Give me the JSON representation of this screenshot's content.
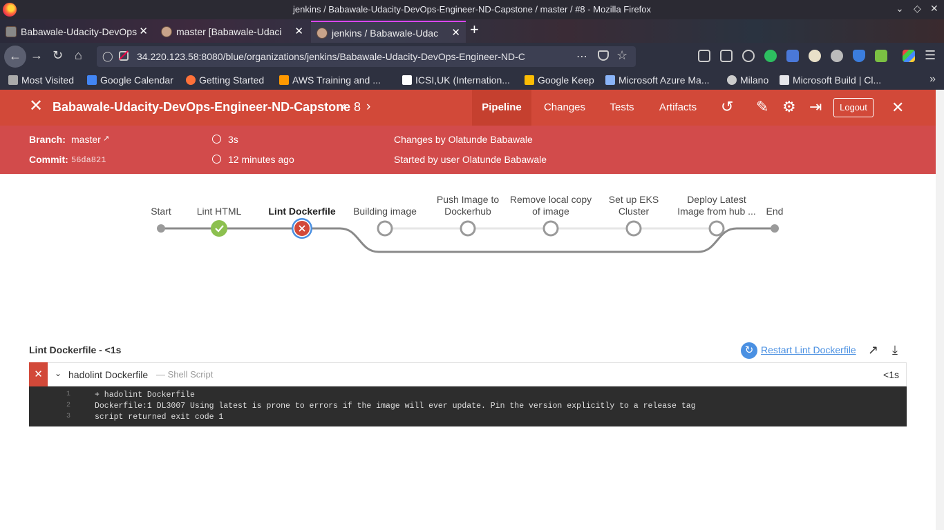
{
  "browser": {
    "window_title": "jenkins / Babawale-Udacity-DevOps-Engineer-ND-Capstone / master / #8 - Mozilla Firefox",
    "tabs": [
      {
        "label": "Babawale-Udacity-DevOps"
      },
      {
        "label": "master [Babawale-Udaci"
      },
      {
        "label": "jenkins / Babawale-Udac"
      }
    ],
    "url": "34.220.123.58:8080/blue/organizations/jenkins/Babawale-Udacity-DevOps-Engineer-ND-C",
    "extension_badge": "3",
    "bookmarks": [
      {
        "label": "Most Visited",
        "color": "#aaaaaa"
      },
      {
        "label": "Google Calendar",
        "color": "#4285f4"
      },
      {
        "label": "Getting Started",
        "color": "#ff7139"
      },
      {
        "label": "AWS Training and ...",
        "color": "#f90"
      },
      {
        "label": "ICSI,UK (Internation...",
        "color": "#ffffff"
      },
      {
        "label": "Google Keep",
        "color": "#fbbc04"
      },
      {
        "label": "Microsoft Azure Ma...",
        "color": "#8ab4f8"
      },
      {
        "label": "Milano",
        "color": "#cccccc"
      },
      {
        "label": "Microsoft Build | Cl...",
        "color": "#e6e6ea"
      }
    ]
  },
  "jenkins": {
    "pipeline_name": "Babawale-Udacity-DevOps-Engineer-ND-Capstone",
    "run_number": "8",
    "tabs": [
      {
        "label": "Pipeline",
        "active": true
      },
      {
        "label": "Changes",
        "active": false
      },
      {
        "label": "Tests",
        "active": false
      },
      {
        "label": "Artifacts",
        "active": false
      }
    ],
    "logout_label": "Logout",
    "branch_label": "Branch:",
    "branch_value": "master",
    "commit_label": "Commit:",
    "commit_value": "56da821",
    "duration": "3s",
    "started_ago": "12 minutes ago",
    "changes_by": "Changes by Olatunde Babawale",
    "started_by": "Started by user Olatunde Babawale",
    "colors": {
      "header": "#d24939",
      "success": "#8cc04f",
      "failure": "#d24939",
      "not_built": "#9a9a9a"
    }
  },
  "pipeline": {
    "stages": [
      {
        "name": "Start",
        "status": "terminal"
      },
      {
        "name": "Lint HTML",
        "status": "success"
      },
      {
        "name": "Lint Dockerfile",
        "status": "failure",
        "selected": true
      },
      {
        "name": "Building image",
        "status": "not_built"
      },
      {
        "name": "Push Image to Dockerhub",
        "status": "not_built"
      },
      {
        "name": "Remove local copy of image",
        "status": "not_built"
      },
      {
        "name": "Set up EKS Cluster",
        "status": "not_built"
      },
      {
        "name": "Deploy Latest Image from hub ...",
        "status": "not_built"
      },
      {
        "name": "End",
        "status": "terminal"
      }
    ]
  },
  "log": {
    "title": "Lint Dockerfile - <1s",
    "restart_label": "Restart Lint Dockerfile",
    "step_name": "hadolint Dockerfile",
    "step_type": "— Shell Script",
    "step_duration": "<1s",
    "lines": [
      {
        "n": "1",
        "text": "+ hadolint Dockerfile"
      },
      {
        "n": "2",
        "text": "Dockerfile:1 DL3007 Using latest is prone to errors if the image will ever update. Pin the version explicitly to a release tag"
      },
      {
        "n": "3",
        "text": "script returned exit code 1"
      }
    ]
  }
}
